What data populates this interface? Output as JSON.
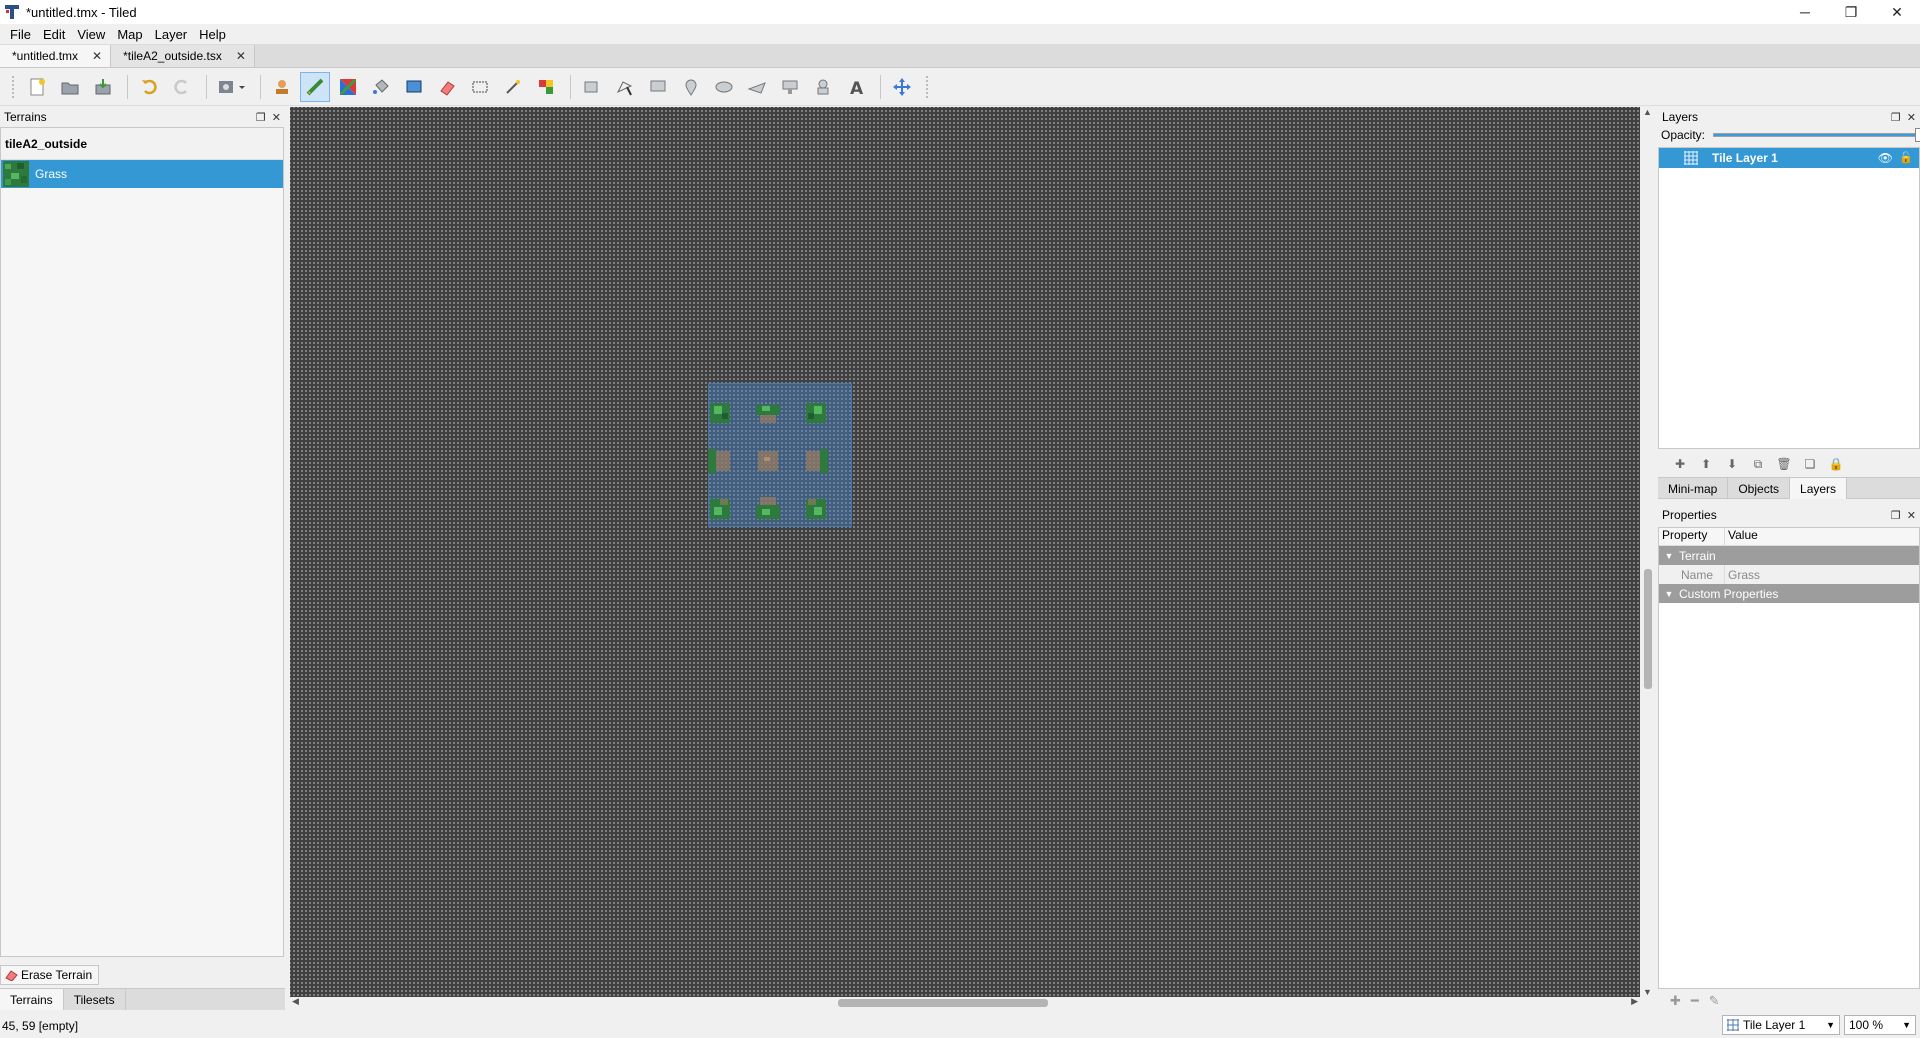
{
  "window": {
    "title": "*untitled.tmx - Tiled",
    "minimize": "─",
    "maximize": "❐",
    "close": "✕"
  },
  "menu": [
    "File",
    "Edit",
    "View",
    "Map",
    "Layer",
    "Help"
  ],
  "doc_tabs": [
    {
      "label": "*untitled.tmx",
      "active": true
    },
    {
      "label": "*tileA2_outside.tsx",
      "active": false
    }
  ],
  "toolbar": {
    "tools": [
      "new-icon",
      "open-icon",
      "save-icon",
      "undo-icon",
      "redo-icon",
      "command-icon",
      "stamp-brush-icon",
      "terrain-brush-icon",
      "wang-brush-icon",
      "bucket-fill-icon",
      "shape-fill-icon",
      "eraser-icon",
      "rect-select-icon",
      "magic-wand-icon",
      "select-same-tile-icon",
      "select-objects-icon",
      "edit-polygons-icon",
      "insert-rectangle-icon",
      "insert-point-icon",
      "insert-ellipse-icon",
      "insert-polygon-icon",
      "insert-tile-icon",
      "insert-template-icon",
      "insert-text-icon",
      "move-icon"
    ],
    "selected": "terrain-brush-icon"
  },
  "terrains_panel": {
    "title": "Terrains",
    "tileset_name": "tileA2_outside",
    "terrains": [
      {
        "name": "Grass",
        "selected": true
      }
    ],
    "erase_label": "Erase Terrain",
    "tabs": [
      {
        "label": "Terrains",
        "active": true
      },
      {
        "label": "Tilesets",
        "active": false
      }
    ]
  },
  "layers_panel": {
    "title": "Layers",
    "opacity_label": "Opacity:",
    "opacity": 1.0,
    "layers": [
      {
        "name": "Tile Layer 1",
        "visible": true,
        "selected": true
      }
    ]
  },
  "right_tabs": [
    {
      "label": "Mini-map",
      "active": false
    },
    {
      "label": "Objects",
      "active": false
    },
    {
      "label": "Layers",
      "active": true
    }
  ],
  "properties_panel": {
    "title": "Properties",
    "col_property": "Property",
    "col_value": "Value",
    "group_terrain": "Terrain",
    "name_key": "Name",
    "name_value": "Grass",
    "group_custom": "Custom Properties"
  },
  "status": {
    "coords": "45, 59 [empty]",
    "current_layer": "Tile Layer 1",
    "zoom": "100 %"
  },
  "colors": {
    "selection": "#3398d4",
    "canvas": "#808080",
    "grass": "#2e7a3e",
    "dirt": "#9a7b5e"
  }
}
